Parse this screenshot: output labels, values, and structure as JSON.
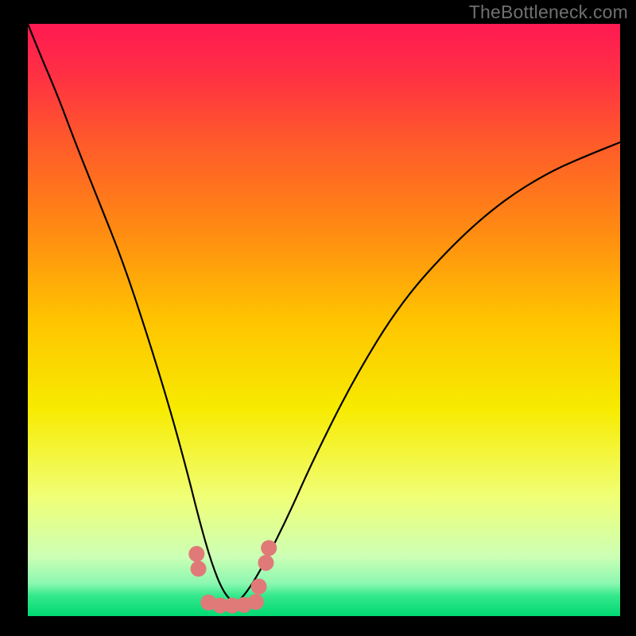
{
  "watermark": "TheBottleneck.com",
  "chart_data": {
    "type": "line",
    "title": "",
    "subtitle": "",
    "xlabel": "",
    "ylabel": "",
    "xlim": [
      0,
      100
    ],
    "ylim": [
      0,
      100
    ],
    "grid": false,
    "legend": false,
    "annotations": [],
    "background_gradient": [
      {
        "pos": 0.0,
        "color": "#ff1a52"
      },
      {
        "pos": 0.08,
        "color": "#ff2e45"
      },
      {
        "pos": 0.2,
        "color": "#ff5a2a"
      },
      {
        "pos": 0.35,
        "color": "#ff8b12"
      },
      {
        "pos": 0.5,
        "color": "#ffc400"
      },
      {
        "pos": 0.65,
        "color": "#f7eb00"
      },
      {
        "pos": 0.8,
        "color": "#f0ff77"
      },
      {
        "pos": 0.9,
        "color": "#ccffb5"
      },
      {
        "pos": 0.945,
        "color": "#8bf7b0"
      },
      {
        "pos": 0.965,
        "color": "#36e98d"
      },
      {
        "pos": 1.0,
        "color": "#00d873"
      }
    ],
    "series": [
      {
        "name": "bottleneck-curve",
        "stroke": "#000000",
        "stroke_width": 2.2,
        "type": "curve",
        "x": [
          0,
          2,
          5,
          8,
          12,
          16,
          20,
          24,
          27,
          29,
          31,
          33,
          35,
          37,
          40,
          44,
          48,
          55,
          63,
          72,
          80,
          88,
          95,
          100
        ],
        "y": [
          100,
          95,
          88,
          80,
          70,
          60,
          48,
          35,
          24,
          16,
          9,
          4,
          2,
          4,
          9,
          17,
          26,
          40,
          53,
          63,
          70,
          75,
          78,
          80
        ]
      },
      {
        "name": "highlight-dots",
        "stroke": "#e07a78",
        "fill": "#e07a78",
        "type": "marker",
        "marker_radius": 10,
        "x": [
          28.5,
          28.8,
          30.5,
          32.5,
          34.5,
          36.5,
          38.5,
          39.0,
          40.2,
          40.7
        ],
        "y": [
          10.5,
          8.0,
          2.3,
          1.8,
          1.8,
          1.9,
          2.4,
          5.0,
          9.0,
          11.5
        ]
      }
    ]
  }
}
